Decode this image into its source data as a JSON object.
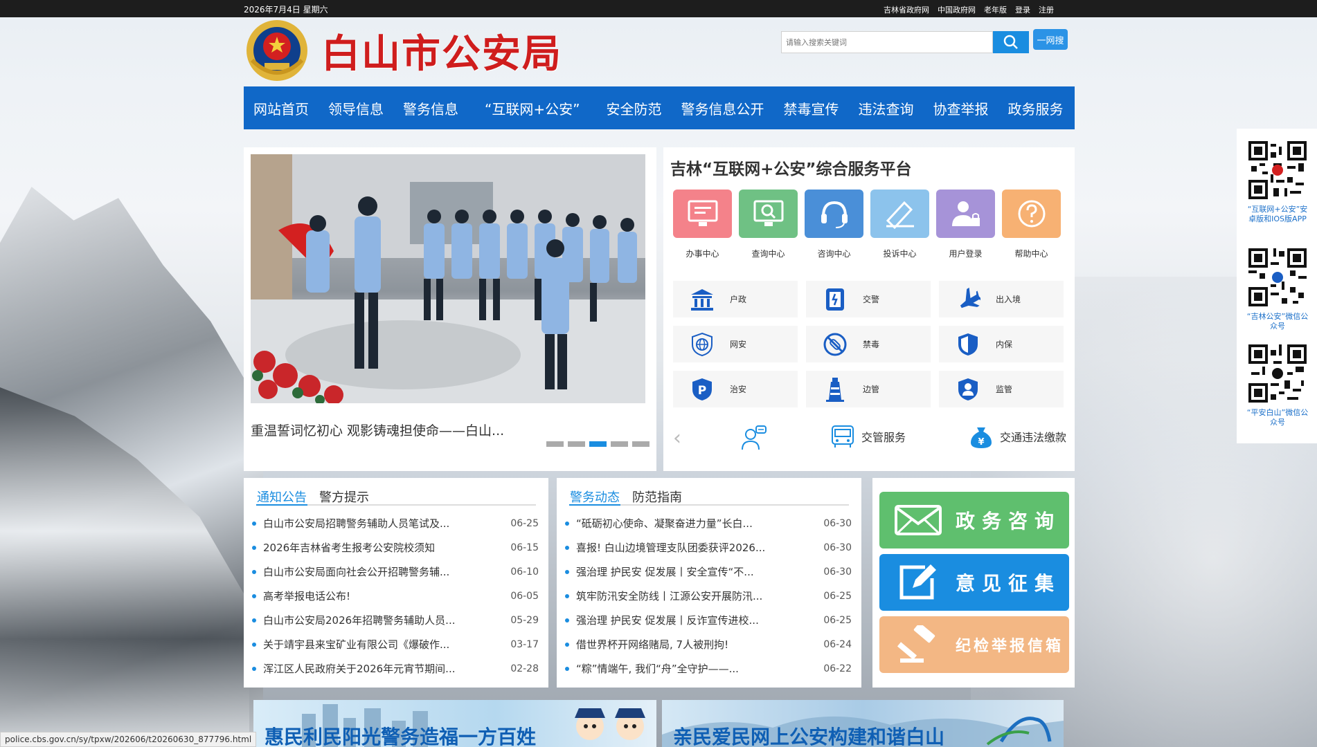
{
  "topbar": {
    "date": "2026年7月4日 星期六",
    "links": [
      "吉林省政府网",
      "中国政府网",
      "老年版",
      "登录",
      "注册"
    ]
  },
  "header": {
    "title": "白山市公安局",
    "search_placeholder": "请输入搜索关键词",
    "wangsou_label": "一网搜"
  },
  "nav": [
    "网站首页",
    "领导信息",
    "警务信息",
    "“互联网+公安”",
    "安全防范",
    "警务信息公开",
    "禁毒宣传",
    "违法查询",
    "协查举报",
    "政务服务"
  ],
  "slideshow": {
    "caption": "重温誓词忆初心 观影铸魂担使命——白山...",
    "dot_count": 5,
    "active_dot": 2
  },
  "service": {
    "title": "吉林“互联网+公安”综合服务平台",
    "centers": [
      {
        "label": "办事中心",
        "color": "#f4828a",
        "icon": "monitor-icon"
      },
      {
        "label": "查询中心",
        "color": "#6fc184",
        "icon": "search-monitor-icon"
      },
      {
        "label": "咨询中心",
        "color": "#4a8fd8",
        "icon": "headset-icon"
      },
      {
        "label": "投诉中心",
        "color": "#8cc3ec",
        "icon": "write-icon"
      },
      {
        "label": "用户登录",
        "color": "#a693d8",
        "icon": "user-lock-icon"
      },
      {
        "label": "帮助中心",
        "color": "#f7b173",
        "icon": "question-icon"
      }
    ],
    "categories": [
      {
        "label": "户政",
        "icon": "building-icon"
      },
      {
        "label": "交警",
        "icon": "traffic-icon"
      },
      {
        "label": "出入境",
        "icon": "airplane-icon"
      },
      {
        "label": "网安",
        "icon": "globe-shield-icon"
      },
      {
        "label": "禁毒",
        "icon": "no-drugs-icon"
      },
      {
        "label": "内保",
        "icon": "shield-icon"
      },
      {
        "label": "治安",
        "icon": "police-badge-icon"
      },
      {
        "label": "边管",
        "icon": "lighthouse-icon"
      },
      {
        "label": "监管",
        "icon": "guard-shield-icon"
      }
    ],
    "carousel": [
      {
        "label": "",
        "icon": "person-chat-icon"
      },
      {
        "label": "交管服务",
        "icon": "bus-icon"
      },
      {
        "label": "交通违法缴款",
        "icon": "money-bag-icon"
      }
    ]
  },
  "news_left": {
    "tabs": [
      "通知公告",
      "警方提示"
    ],
    "items": [
      {
        "title": "白山市公安局招聘警务辅助人员笔试及...",
        "date": "06-25"
      },
      {
        "title": "2026年吉林省考生报考公安院校须知",
        "date": "06-15"
      },
      {
        "title": "白山市公安局面向社会公开招聘警务辅...",
        "date": "06-10"
      },
      {
        "title": "高考举报电话公布!",
        "date": "06-05"
      },
      {
        "title": "白山市公安局2026年招聘警务辅助人员...",
        "date": "05-29"
      },
      {
        "title": "关于靖宇县来宝矿业有限公司《爆破作...",
        "date": "03-17"
      },
      {
        "title": "浑江区人民政府关于2026年元宵节期间...",
        "date": "02-28"
      }
    ]
  },
  "news_right": {
    "tabs": [
      "警务动态",
      "防范指南"
    ],
    "items": [
      {
        "title": "“砥砺初心使命、凝聚奋进力量”长白...",
        "date": "06-30"
      },
      {
        "title": "喜报! 白山边境管理支队团委获评2026...",
        "date": "06-30"
      },
      {
        "title": "强治理 护民安 促发展丨安全宣传“不...",
        "date": "06-30"
      },
      {
        "title": "筑牢防汛安全防线丨江源公安开展防汛...",
        "date": "06-25"
      },
      {
        "title": "强治理 护民安 促发展丨反诈宣传进校...",
        "date": "06-25"
      },
      {
        "title": "借世界杯开网络赌局, 7人被刑拘!",
        "date": "06-24"
      },
      {
        "title": "“粽”情端午, 我们“舟”全守护——...",
        "date": "06-22"
      }
    ]
  },
  "actions": [
    {
      "label": "政务咨询",
      "color": "#5fbf6e",
      "icon": "mail-icon"
    },
    {
      "label": "意见征集",
      "color": "#1a8de0",
      "icon": "edit-icon"
    },
    {
      "label": "纪检举报信箱",
      "color": "#f3b784",
      "icon": "gavel-icon"
    }
  ],
  "banners": [
    {
      "text": "惠民利民阳光警务造福一方百姓"
    },
    {
      "text": "亲民爱民网上公安构建和谐白山"
    }
  ],
  "qr": [
    {
      "label": "“互联网+公安”安卓版和IOS版APP"
    },
    {
      "label": "“吉林公安”微信公众号"
    },
    {
      "label": "“平安白山”微信公众号"
    }
  ],
  "status_url": "police.cbs.gov.cn/sy/tpxw/202606/t20260630_877796.html"
}
